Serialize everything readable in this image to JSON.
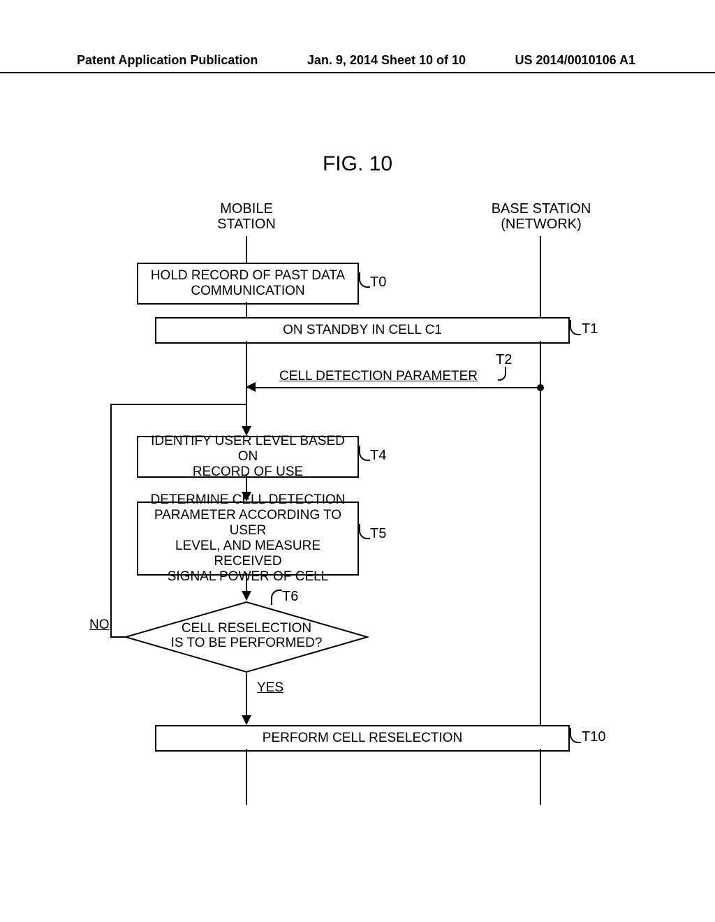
{
  "header": {
    "left": "Patent Application Publication",
    "center": "Jan. 9, 2014  Sheet 10 of 10",
    "right": "US 2014/0010106 A1"
  },
  "figure_title": "FIG. 10",
  "lanes": {
    "mobile": "MOBILE\nSTATION",
    "base": "BASE STATION\n(NETWORK)"
  },
  "steps": {
    "t0": {
      "label": "T0",
      "text": "HOLD RECORD OF PAST DATA\nCOMMUNICATION"
    },
    "t1": {
      "label": "T1",
      "text": "ON STANDBY IN CELL C1"
    },
    "t2": {
      "label": "T2",
      "text": "CELL DETECTION PARAMETER"
    },
    "t4": {
      "label": "T4",
      "text": "IDENTIFY USER LEVEL BASED ON\nRECORD OF USE"
    },
    "t5": {
      "label": "T5",
      "text": "DETERMINE CELL DETECTION\nPARAMETER ACCORDING TO USER\nLEVEL, AND MEASURE RECEIVED\nSIGNAL POWER OF CELL"
    },
    "t6": {
      "label": "T6",
      "text": "CELL RESELECTION\nIS TO BE PERFORMED?"
    },
    "t10": {
      "label": "T10",
      "text": "PERFORM CELL RESELECTION"
    }
  },
  "branches": {
    "yes": "YES",
    "no": "NO"
  }
}
